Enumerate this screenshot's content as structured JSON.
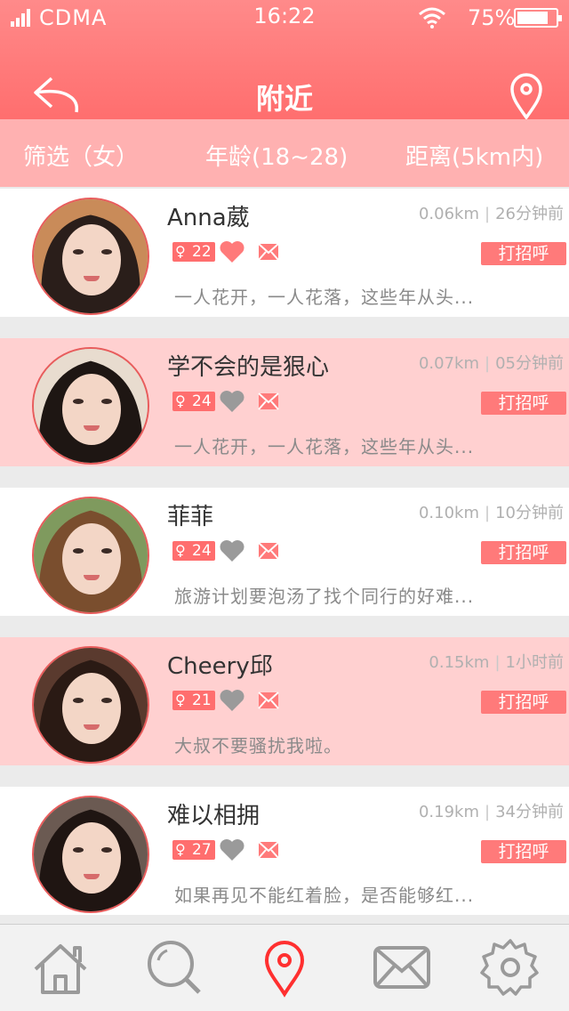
{
  "status": {
    "carrier": "CDMA",
    "time": "16:22",
    "battery": "75%"
  },
  "header": {
    "title": "附近",
    "back_icon": "back-arrow-icon",
    "location_icon": "location-pin-icon"
  },
  "filters": {
    "gender": "筛选（女）",
    "age": "年龄(18~28)",
    "distance": "距离(5km内)"
  },
  "users": [
    {
      "name": "Anna葳",
      "distance": "0.06km",
      "time": "26分钟前",
      "age": "22",
      "liked": true,
      "greet": "打招呼",
      "status": "一人花开，一人花落，这些年从头..."
    },
    {
      "name": "学不会的是狠心",
      "distance": "0.07km",
      "time": "05分钟前",
      "age": "24",
      "liked": false,
      "greet": "打招呼",
      "status": "一人花开，一人花落，这些年从头..."
    },
    {
      "name": "菲菲",
      "distance": "0.10km",
      "time": "10分钟前",
      "age": "24",
      "liked": false,
      "greet": "打招呼",
      "status": "旅游计划要泡汤了找个同行的好难..."
    },
    {
      "name": "Cheery邱",
      "distance": "0.15km",
      "time": "1小时前",
      "age": "21",
      "liked": false,
      "greet": "打招呼",
      "status": "大叔不要骚扰我啦。"
    },
    {
      "name": "难以相拥",
      "distance": "0.19km",
      "time": "34分钟前",
      "age": "27",
      "liked": false,
      "greet": "打招呼",
      "status": "如果再见不能红着脸，是否能够红..."
    }
  ],
  "tabbar": [
    {
      "icon": "home-icon",
      "active": false
    },
    {
      "icon": "search-icon",
      "active": false
    },
    {
      "icon": "location-pin-icon",
      "active": true
    },
    {
      "icon": "mail-icon",
      "active": false
    },
    {
      "icon": "gear-icon",
      "active": false
    }
  ],
  "colors": {
    "accent": "#ff6e6e",
    "row_alt": "#ffd0d0",
    "filter_bar": "#ffb1b1"
  }
}
